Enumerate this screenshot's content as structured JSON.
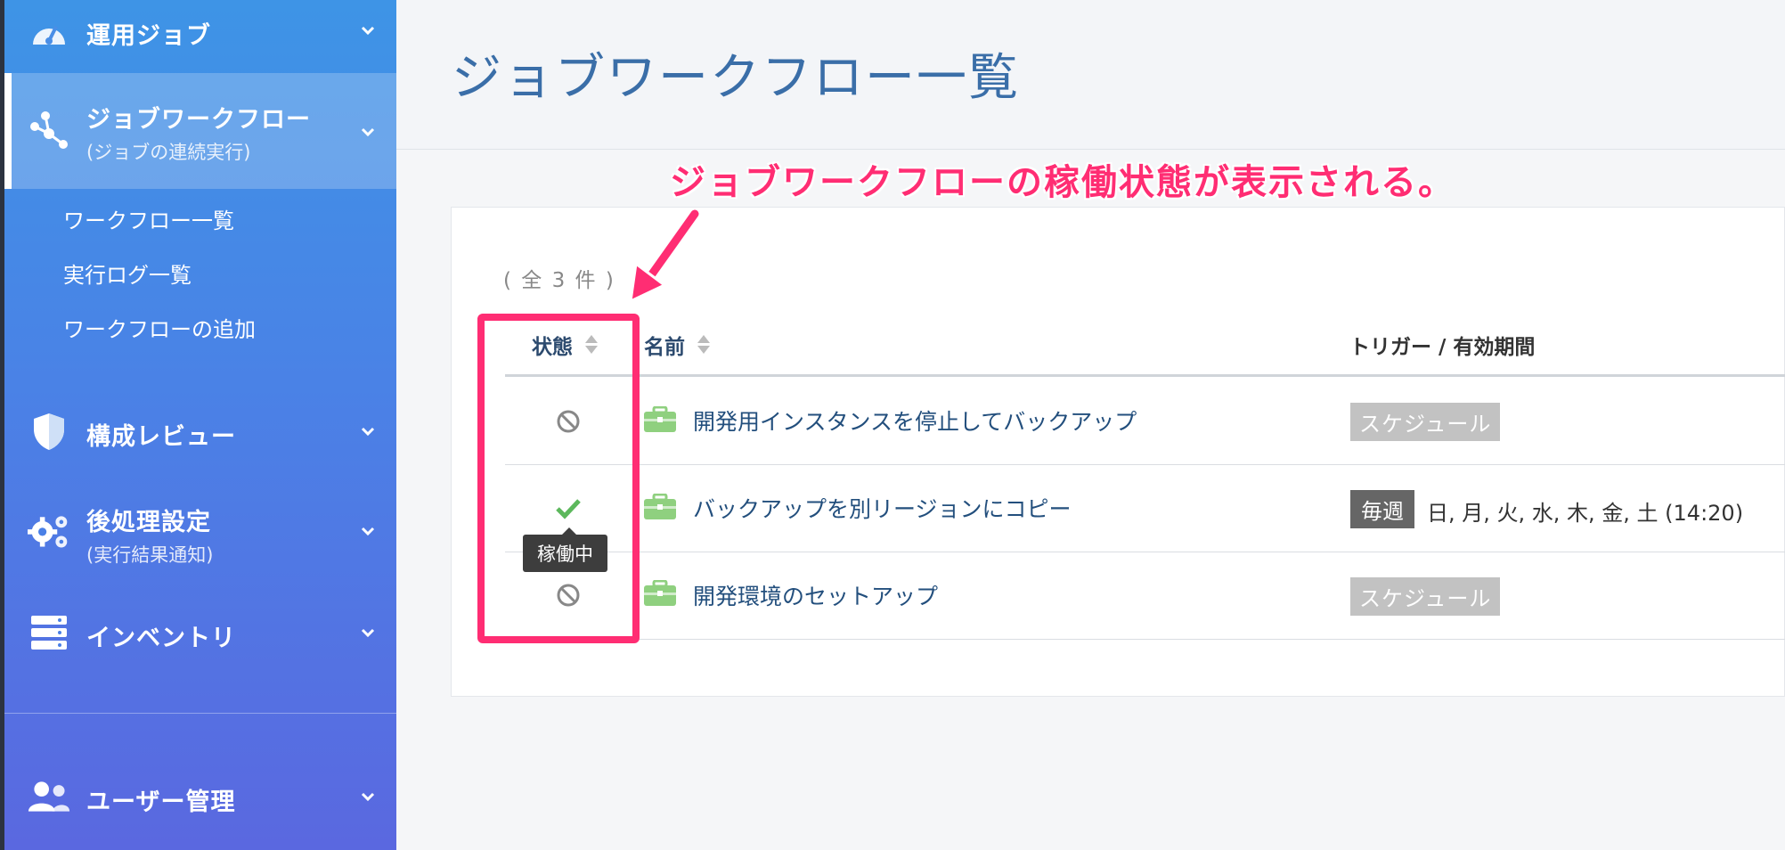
{
  "sidebar": {
    "items": [
      {
        "title": "運用ジョブ",
        "icon": "dashboard-icon"
      },
      {
        "title": "ジョブワークフロー",
        "subtitle": "(ジョブの連続実行)",
        "icon": "workflow-icon",
        "active": true
      },
      {
        "title": "構成レビュー",
        "icon": "shield-icon"
      },
      {
        "title": "後処理設定",
        "subtitle": "(実行結果通知)",
        "icon": "gears-icon"
      },
      {
        "title": "インベントリ",
        "icon": "server-icon"
      },
      {
        "title": "ユーザー管理",
        "icon": "users-icon"
      }
    ],
    "subitems": [
      "ワークフロー一覧",
      "実行ログ一覧",
      "ワークフローの追加"
    ]
  },
  "header": {
    "title": "ジョブワークフロー一覧"
  },
  "table": {
    "count": "( 全 3 件 )",
    "columns": {
      "status": "状態",
      "name": "名前",
      "trigger": "トリガー / 有効期間"
    },
    "rows": [
      {
        "status": "disabled",
        "name": "開発用インスタンスを停止してバックアップ",
        "trigger": "スケジュール"
      },
      {
        "status": "active",
        "name": "バックアップを別リージョンにコピー",
        "trigger": "毎週",
        "days": "日, 月, 火, 水, 木, 金, 土 (14:20)"
      },
      {
        "status": "disabled",
        "name": "開発環境のセットアップ",
        "trigger": "スケジュール"
      }
    ],
    "tooltip": "稼働中"
  },
  "annotation": {
    "text": "ジョブワークフローの稼働状態が表示される。",
    "color": "#ff2d73"
  },
  "colors": {
    "accent": "#3a6ea8",
    "active_check": "#5cb85c",
    "disabled": "#888888"
  }
}
